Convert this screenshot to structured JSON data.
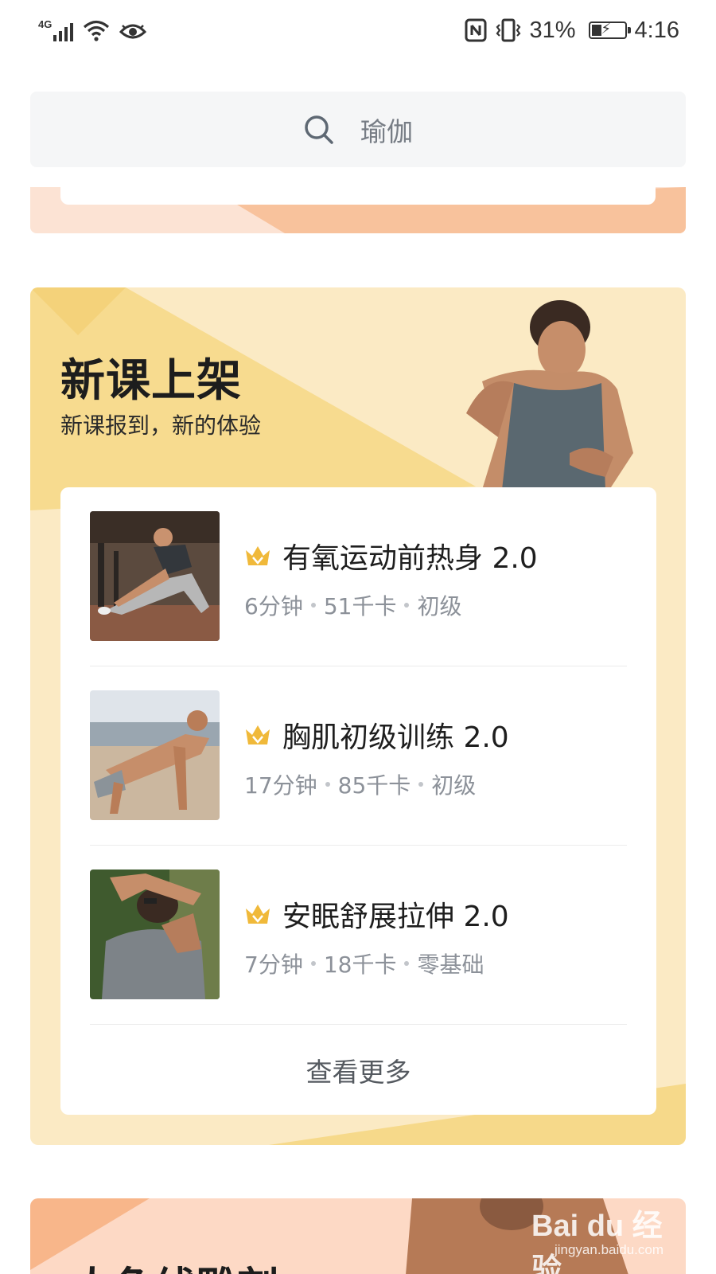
{
  "status_bar": {
    "network_type": "4G",
    "battery_percent": "31%",
    "time": "4:16",
    "icons": [
      "signal-icon",
      "wifi-icon",
      "eye-icon",
      "nfc-icon",
      "vibrate-icon",
      "battery-icon"
    ]
  },
  "search": {
    "placeholder": "瑜伽",
    "icon": "search-icon"
  },
  "new_courses": {
    "title": "新课上架",
    "subtitle": "新课报到，新的体验",
    "courses": [
      {
        "title": "有氧运动前热身 2.0",
        "duration": "6分钟",
        "calories": "51千卡",
        "level": "初级",
        "badge_icon": "crown-icon"
      },
      {
        "title": "胸肌初级训练 2.0",
        "duration": "17分钟",
        "calories": "85千卡",
        "level": "初级",
        "badge_icon": "crown-icon"
      },
      {
        "title": "安眠舒展拉伸 2.0",
        "duration": "7分钟",
        "calories": "18千卡",
        "level": "零基础",
        "badge_icon": "crown-icon"
      }
    ],
    "more_label": "查看更多"
  },
  "next_section": {
    "title": "人鱼线雕刻"
  },
  "watermark": {
    "logo": "Bai du 经验",
    "url": "jingyan.baidu.com"
  },
  "colors": {
    "section_bg": "#fbeac4",
    "section_accent": "#f6d98a",
    "peach_bg": "#fce3d4",
    "peach_accent": "#f8c29c",
    "meta_text": "#8c9199",
    "crown": "#f0b93a"
  }
}
